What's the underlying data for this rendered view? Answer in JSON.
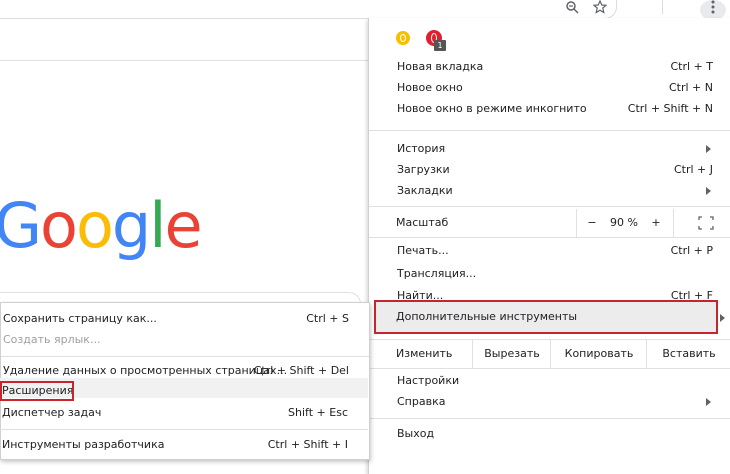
{
  "toolbar": {
    "zoom_icon": "zoom-magnifier-icon",
    "bookmark_icon": "star-icon",
    "menu_icon": "kebab-icon"
  },
  "page": {
    "logo_letters": [
      "G",
      "o",
      "o",
      "g",
      "l",
      "e"
    ],
    "logo_colors": [
      "#4285F4",
      "#EA4335",
      "#FBBC05",
      "#4285F4",
      "#34A853",
      "#EA4335"
    ]
  },
  "extensions": {
    "badge_count": "1"
  },
  "menu": {
    "new_tab": {
      "label": "Новая вкладка",
      "shortcut": "Ctrl + T"
    },
    "new_window": {
      "label": "Новое окно",
      "shortcut": "Ctrl + N"
    },
    "incognito": {
      "label": "Новое окно в режиме инкогнито",
      "shortcut": "Ctrl + Shift + N"
    },
    "history": {
      "label": "История"
    },
    "downloads": {
      "label": "Загрузки",
      "shortcut": "Ctrl + J"
    },
    "bookmarks": {
      "label": "Закладки"
    },
    "zoom": {
      "label": "Масштаб",
      "minus": "−",
      "value": "90 %",
      "plus": "+"
    },
    "print": {
      "label": "Печать...",
      "shortcut": "Ctrl + P"
    },
    "cast": {
      "label": "Трансляция..."
    },
    "find": {
      "label": "Найти...",
      "shortcut": "Ctrl + F"
    },
    "more_tools": {
      "label": "Дополнительные инструменты"
    },
    "edit": {
      "label": "Изменить",
      "cut": "Вырезать",
      "copy": "Копировать",
      "paste": "Вставить"
    },
    "settings": {
      "label": "Настройки"
    },
    "help": {
      "label": "Справка"
    },
    "exit": {
      "label": "Выход"
    }
  },
  "submenu": {
    "save_page": {
      "label": "Сохранить страницу как...",
      "shortcut": "Ctrl + S"
    },
    "create_shortcut": {
      "label": "Создать ярлык..."
    },
    "clear_data": {
      "label": "Удаление данных о просмотренных страницах...",
      "shortcut": "Ctrl + Shift + Del"
    },
    "extensions": {
      "label": "Расширения"
    },
    "task_manager": {
      "label": "Диспетчер задач",
      "shortcut": "Shift + Esc"
    },
    "dev_tools": {
      "label": "Инструменты разработчика",
      "shortcut": "Ctrl + Shift + I"
    }
  },
  "accent": {
    "highlight_border": "#C8242E",
    "hover_bg": "#ECECEC"
  }
}
